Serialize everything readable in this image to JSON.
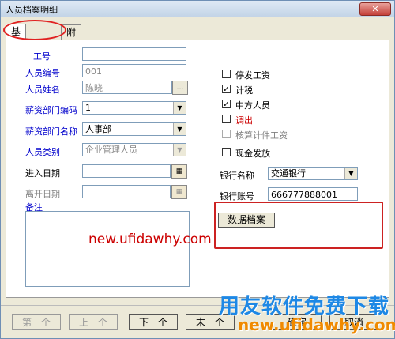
{
  "window": {
    "title": "人员档案明细",
    "close": "✕"
  },
  "tabs": [
    {
      "label": "基本信息"
    },
    {
      "label": "附加信息"
    }
  ],
  "fields": {
    "emp_no_label": "工号",
    "emp_no_value": "",
    "code_label": "人员编号",
    "code_value": "001",
    "name_label": "人员姓名",
    "name_value": "陈晓",
    "salary_dept_code_label": "薪资部门编码",
    "salary_dept_code_value": "1",
    "salary_dept_name_label": "薪资部门名称",
    "salary_dept_name_value": "人事部",
    "category_label": "人员类别",
    "category_value": "企业管理人员",
    "entry_date_label": "进入日期",
    "entry_date_value": "",
    "leave_date_label": "离开日期",
    "leave_date_value": "",
    "memo_label": "备注"
  },
  "checkboxes": [
    {
      "label": "停发工资",
      "checked": false,
      "enabled": true,
      "color": "#000000"
    },
    {
      "label": "计税",
      "checked": true,
      "enabled": true,
      "color": "#000000"
    },
    {
      "label": "中方人员",
      "checked": true,
      "enabled": true,
      "color": "#000000"
    },
    {
      "label": "调出",
      "checked": false,
      "enabled": true,
      "color": "#cc0000"
    },
    {
      "label": "核算计件工资",
      "checked": false,
      "enabled": false,
      "color": "#808080"
    },
    {
      "label": "现金发放",
      "checked": false,
      "enabled": true,
      "color": "#000000"
    }
  ],
  "bank": {
    "name_label": "银行名称",
    "name_value": "交通银行",
    "account_label": "银行账号",
    "account_value": "666777888001"
  },
  "buttons": {
    "data_archive": "数据档案",
    "first": "第一个",
    "prev": "上一个",
    "next": "下一个",
    "last": "末一个",
    "ok": "确定",
    "cancel": "取消"
  },
  "icons": {
    "calendar": "calendar-icon",
    "ellipsis": "ellipsis-icon",
    "dropdown": "chevron-down-icon"
  },
  "watermarks": {
    "center": "new.ufidawhy.com",
    "brand": "用友软件免费下载",
    "brand_url": "new.ufidawhy.com"
  },
  "colors": {
    "label_blue": "#0000cc",
    "highlight_red": "#cc2222",
    "brand_blue": "#1e88e5",
    "brand_orange": "#f08a00"
  }
}
